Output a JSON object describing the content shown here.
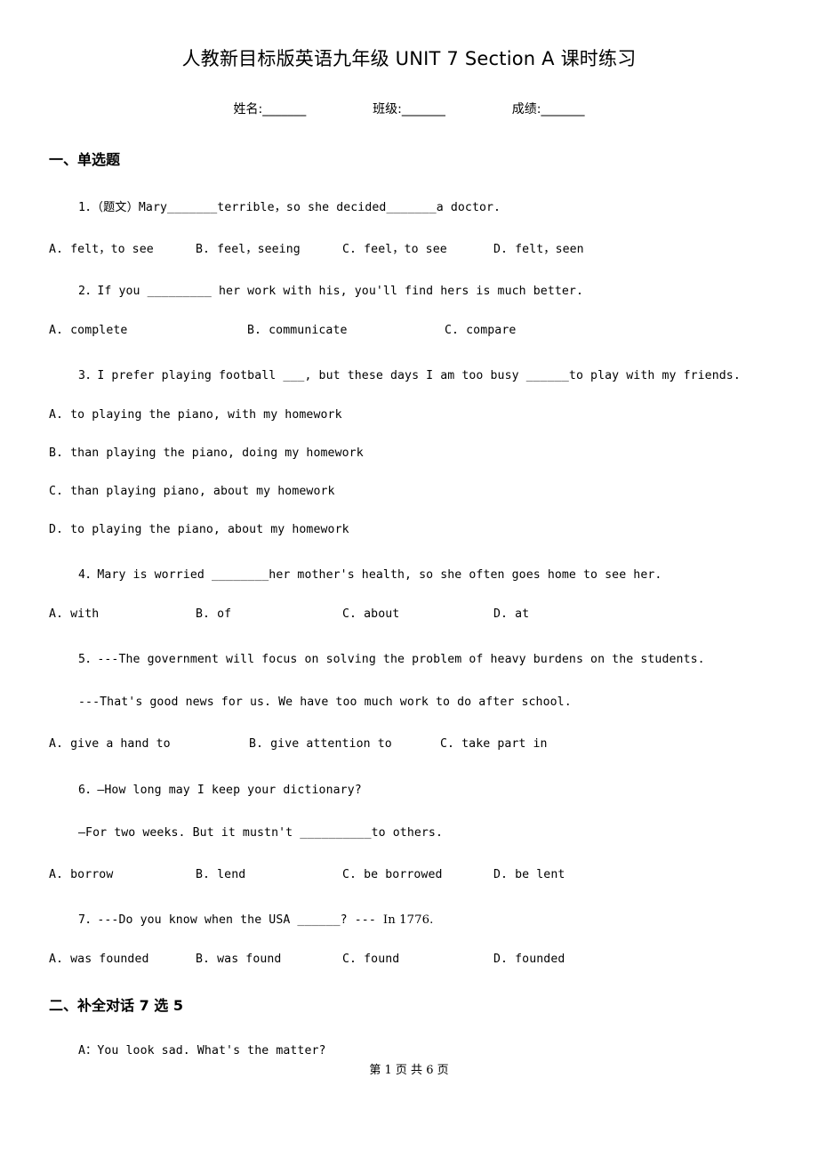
{
  "document": {
    "title": "人教新目标版英语九年级 UNIT 7 Section A 课时练习",
    "fields": {
      "name_label": "姓名:_______",
      "class_label": "班级:_______",
      "score_label": "成绩:_______"
    },
    "footer": "第 1 页 共 6 页"
  },
  "sections": [
    {
      "heading": "一、单选题"
    },
    {
      "heading": "二、补全对话 7 选 5"
    }
  ],
  "questions": [
    {
      "number": "1",
      "stem": "1．（题文）Mary_______terrible，so she decided_______a doctor.",
      "options": [
        "A. felt，to see",
        "B. feel，seeing",
        "C. feel，to see",
        "D. felt，seen"
      ]
    },
    {
      "number": "2",
      "stem": "2．If you _________ her work with his, you'll find hers is much better.",
      "options": [
        "A. complete",
        "B. communicate",
        "C. compare"
      ]
    },
    {
      "number": "3",
      "stem": "3．I prefer playing football ___, but these days I am too busy ______to play with my friends.",
      "options": [
        "A. to playing the piano, with my homework",
        "B. than playing the piano, doing my homework",
        "C. than playing piano, about my homework",
        "D. to playing the piano, about my homework"
      ]
    },
    {
      "number": "4",
      "stem": "4．Mary is worried ________her mother's health, so she often goes home to see her.",
      "options": [
        "A. with",
        "B. of",
        "C. about",
        "D. at"
      ]
    },
    {
      "number": "5",
      "stem_line1": "5．---The government will focus on solving the problem of heavy burdens on the students.",
      "stem_line2": "---That's good news for us. We have too much work to do after school.",
      "options": [
        "A. give a hand to",
        "B. give attention to",
        "C. take part in"
      ]
    },
    {
      "number": "6",
      "stem_line1": "6．—How long may I keep your dictionary?",
      "stem_line2": "—For two weeks. But it mustn't __________to others.",
      "options": [
        "A. borrow",
        "B. lend",
        "C. be borrowed",
        "D. be lent"
      ]
    },
    {
      "number": "7",
      "stem_prefix": "7．---Do you know when the USA ______? --- ",
      "stem_serif": "In 1776.",
      "options": [
        "A. was founded",
        "B. was found",
        "C. found",
        "D. founded"
      ]
    }
  ],
  "dialogue": {
    "line1": "A：You look sad. What's the matter?"
  }
}
